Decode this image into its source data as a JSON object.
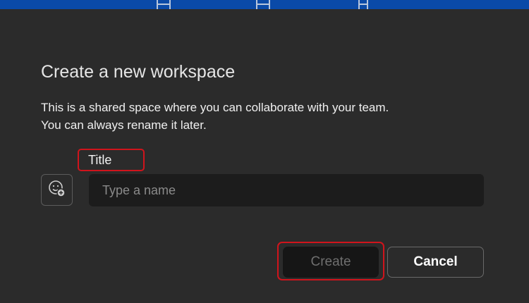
{
  "dialog": {
    "title": "Create a new workspace",
    "description_line1": "This is a shared space where you can collaborate with your team.",
    "description_line2": "You can always rename it later.",
    "field_label": "Title",
    "name_input": {
      "value": "",
      "placeholder": "Type a name"
    },
    "icon_picker": "emoji-add-icon",
    "create_label": "Create",
    "cancel_label": "Cancel"
  },
  "colors": {
    "highlight": "#d0141c",
    "banner": "#0a4aa8"
  }
}
